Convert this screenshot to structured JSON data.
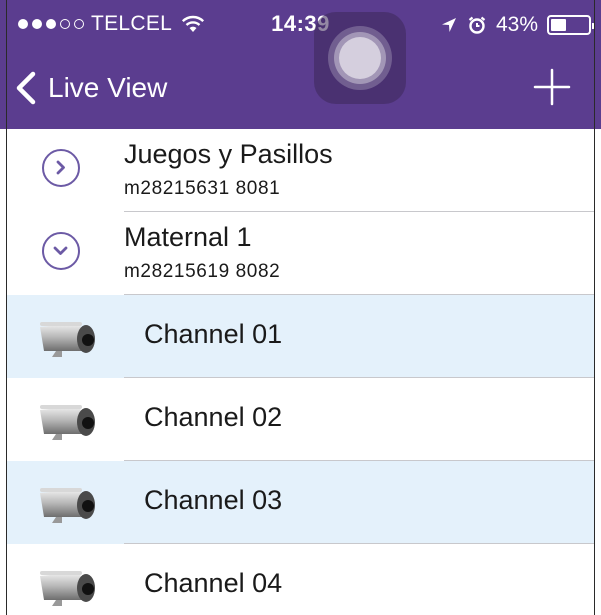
{
  "status_bar": {
    "signal_bars_filled": 3,
    "signal_bars_total": 5,
    "carrier": "TELCEL",
    "time": "14:39",
    "battery_percent": "43%",
    "battery_level": 0.43
  },
  "nav": {
    "back_label": "Live View",
    "add_icon": "plus-icon"
  },
  "devices": [
    {
      "name": "Juegos y Pasillos",
      "detail": "m28215631  8081",
      "expanded": false
    },
    {
      "name": "Maternal 1",
      "detail": "m28215619  8082",
      "expanded": true
    }
  ],
  "channels": [
    {
      "label": "Channel 01",
      "highlighted": true
    },
    {
      "label": "Channel 02",
      "highlighted": false
    },
    {
      "label": "Channel 03",
      "highlighted": true
    },
    {
      "label": "Channel 04",
      "highlighted": false
    }
  ],
  "colors": {
    "accent": "#5b3d8f",
    "row_highlight": "#e4f1fb",
    "chevron": "#6c5aa5"
  }
}
